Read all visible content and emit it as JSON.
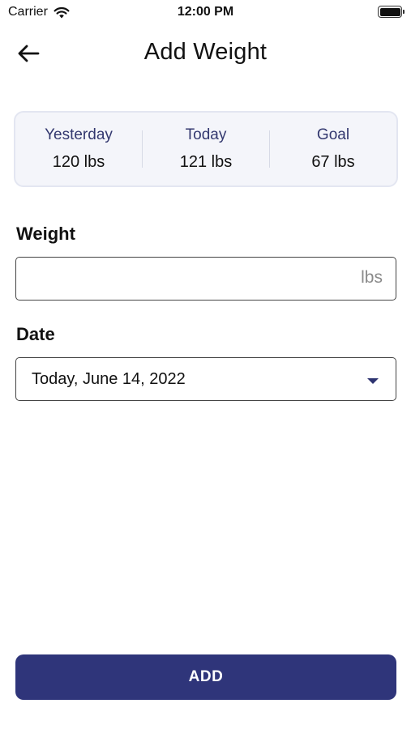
{
  "status_bar": {
    "carrier": "Carrier",
    "time": "12:00 PM"
  },
  "header": {
    "title": "Add Weight",
    "back_icon": "arrow-left-icon"
  },
  "summary": {
    "items": [
      {
        "label": "Yesterday",
        "value": "120 lbs"
      },
      {
        "label": "Today",
        "value": "121 lbs"
      },
      {
        "label": "Goal",
        "value": "67 lbs"
      }
    ]
  },
  "form": {
    "weight": {
      "label": "Weight",
      "value": "",
      "unit": "lbs"
    },
    "date": {
      "label": "Date",
      "selected": "Today, June 14, 2022",
      "icon": "caret-down-icon"
    }
  },
  "actions": {
    "add_label": "ADD"
  },
  "colors": {
    "primary": "#2f357a",
    "label_text": "#33386f",
    "card_background": "#f4f5fa",
    "card_border": "#e3e6f1"
  }
}
